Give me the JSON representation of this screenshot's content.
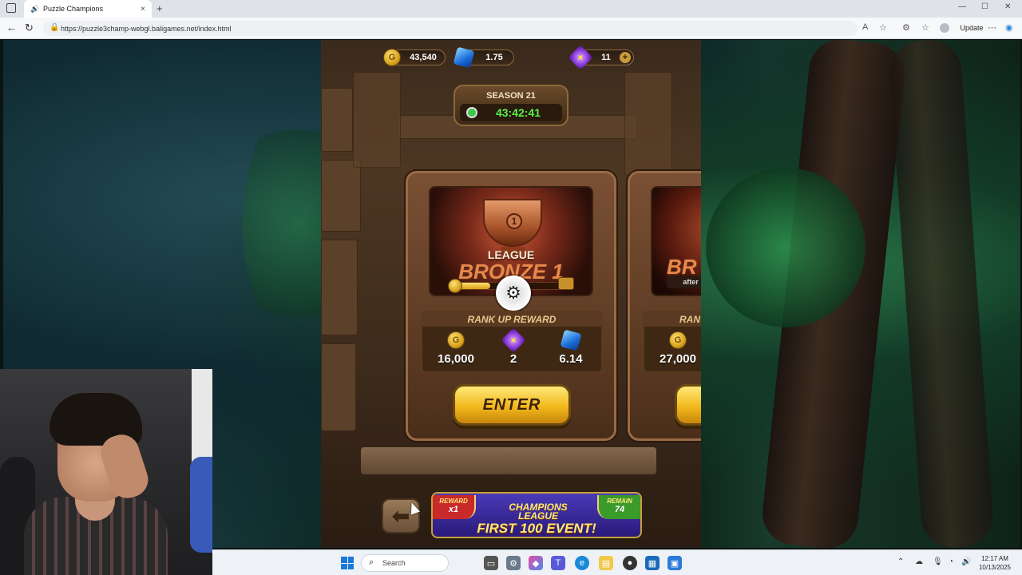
{
  "browser": {
    "tab_title": "Puzzle Champions",
    "tab_close": "×",
    "new_tab": "+",
    "url": "https://puzzle3champ-webgl.baligames.net/index.html",
    "update_label": "Update",
    "more_label": "⋯",
    "window_min": "—",
    "window_max": "☐",
    "window_close": "✕"
  },
  "hud": {
    "gold": "43,540",
    "gems": "1.75",
    "stars": "11",
    "gold_symbol": "G"
  },
  "season": {
    "title": "SEASON 21",
    "time_left": "43:42:41"
  },
  "league_card": {
    "trophy_number": "1",
    "league_word": "LEAGUE",
    "league_name": "BRONZE 1",
    "progress_fraction": 0.3,
    "reward_title": "RANK UP REWARD",
    "rewards": [
      {
        "type": "gold",
        "value": "16,000"
      },
      {
        "type": "star",
        "value": "2"
      },
      {
        "type": "gem",
        "value": "6.14"
      }
    ],
    "enter_label": "ENTER"
  },
  "next_card": {
    "league_name_partial": "BR",
    "after_label": "after",
    "reward_title_partial": "RAN",
    "reward_gold": "27,000"
  },
  "event_banner": {
    "reward_tag": "REWARD",
    "reward_value": "x1",
    "remain_tag": "REMAIN",
    "remain_value": "74",
    "champ_line1": "CHAMPIONS",
    "champ_line2": "LEAGUE",
    "first_line": "FIRST 100 EVENT!"
  },
  "taskbar": {
    "search_label": "Search",
    "time": "12:17 AM",
    "date": "10/13/2025"
  },
  "colors": {
    "accent_gold": "#f2b81c",
    "timer_green": "#5af04a",
    "bronze": "#e8884a"
  }
}
